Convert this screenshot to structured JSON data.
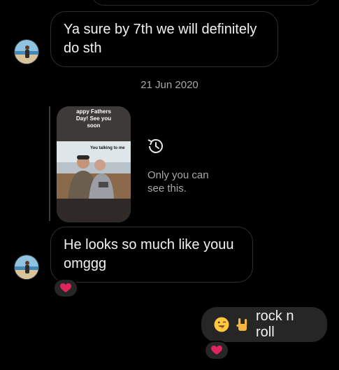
{
  "messages": {
    "first": "Ya sure by 7th we will definitely do sth",
    "second": "He looks so much like youu omggg",
    "mine": "rock n roll"
  },
  "date_separator": "21 Jun 2020",
  "story": {
    "caption": "appy Fathers\nDay! See you\nsoon",
    "sticker": "You talking to me",
    "visibility_note": "Only you can\nsee this."
  },
  "reactions": {
    "second_message": "heart",
    "mine": "heart"
  },
  "colors": {
    "heart": "#e0245e",
    "bubble_out": "#262626",
    "muted_text": "#a8a8a8"
  }
}
